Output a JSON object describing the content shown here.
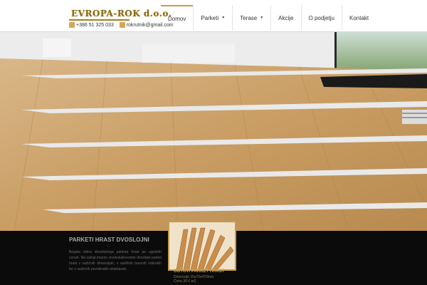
{
  "header": {
    "logo_text": "EVROPA-ROK d.o.o.",
    "phone": "+386 51 325 033",
    "email": "rokrutnik@gmail.com"
  },
  "nav": {
    "items": [
      {
        "label": "Domov"
      },
      {
        "label": "Parketi"
      },
      {
        "label": "Terase"
      },
      {
        "label": "Akcije"
      },
      {
        "label": "O podjetju"
      },
      {
        "label": "Kontakt"
      }
    ]
  },
  "info": {
    "title": "PARKETI HRAST DVOSLOJNI",
    "text": "Bogata izbira dvoslojnega parketa hrast po ugodnih cenah. Na zalogi imamo visokokakovostni dvoslojni parket hrast v različnih dimenzijah, v različnih barvnih odtenkih ter v različnih površinskih obdelavah."
  },
  "product": {
    "caption": "GOTOVI PARKET HRAST",
    "subtitle": "Dimenzije 15x70x470mm",
    "price": "Cena 30 € m2"
  },
  "colors": {
    "accent": "#c59d4a",
    "dark_band": "#0b0b0b"
  },
  "icons": [
    "phone-icon",
    "email-icon",
    "chevron-down-icon"
  ]
}
